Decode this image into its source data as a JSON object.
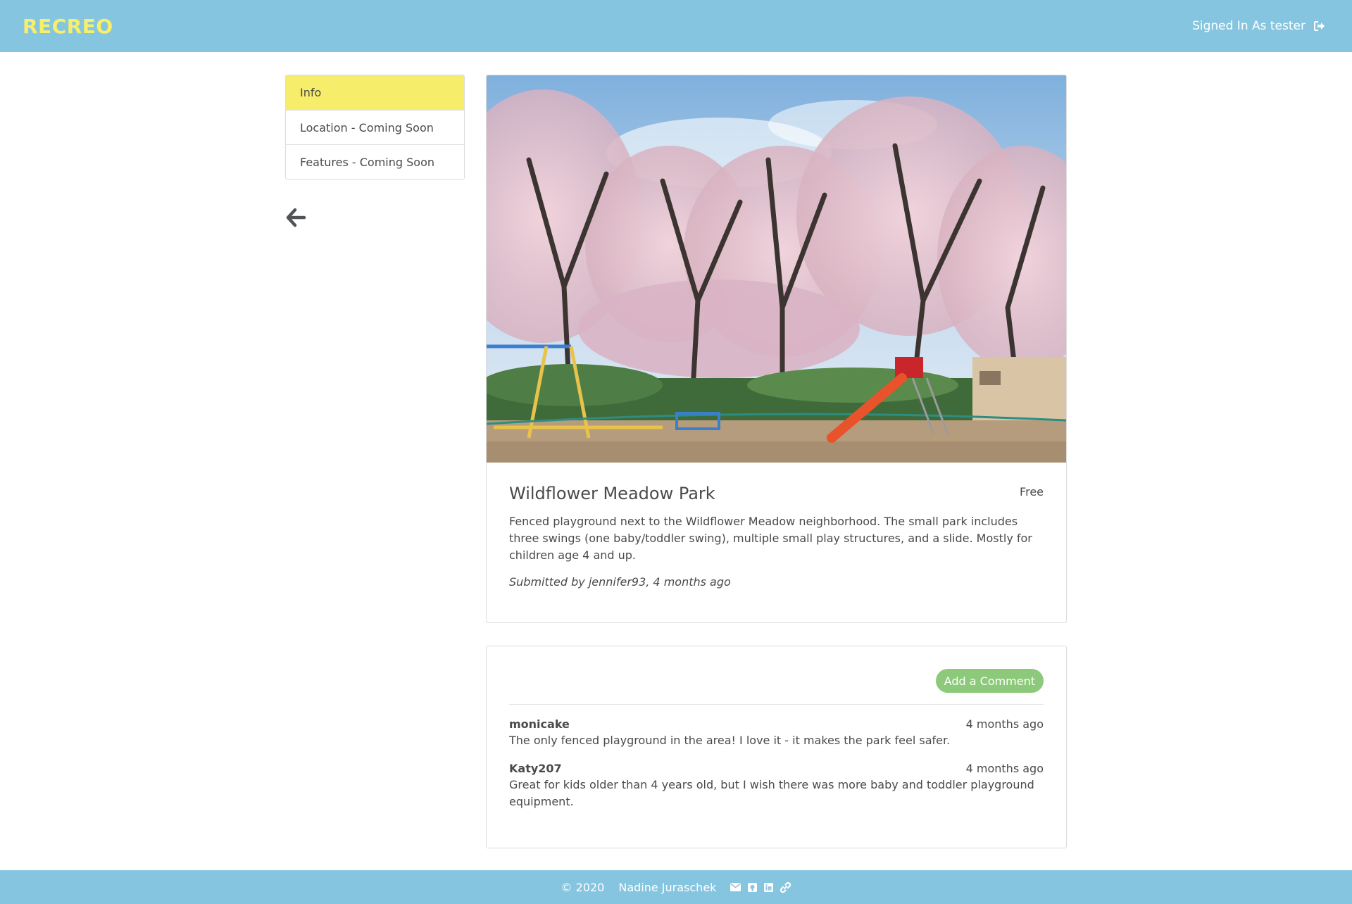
{
  "navbar": {
    "brand": "RECREO",
    "signed_in_text": "Signed In As tester",
    "signout_icon": "sign-out-icon"
  },
  "sidebar": {
    "items": [
      {
        "label": "Info",
        "active": true
      },
      {
        "label": "Location - Coming Soon",
        "active": false
      },
      {
        "label": "Features - Coming Soon",
        "active": false
      }
    ],
    "back_icon": "arrow-left-icon"
  },
  "park": {
    "title": "Wildflower Meadow Park",
    "price": "Free",
    "description": "Fenced playground next to the Wildflower Meadow neighborhood. The small park includes three swings (one baby/toddler swing), multiple small play structures, and a slide. Mostly for children age 4 and up.",
    "submitted": "Submitted by jennifer93, 4 months ago"
  },
  "comments": {
    "add_button": "Add a Comment",
    "items": [
      {
        "author": "monicake",
        "time": "4 months ago",
        "text": "The only fenced playground in the area! I love it - it makes the park feel safer."
      },
      {
        "author": "Katy207",
        "time": "4 months ago",
        "text": "Great for kids older than 4 years old, but I wish there was more baby and toddler playground equipment."
      }
    ]
  },
  "footer": {
    "copyright": "© 2020",
    "author": "Nadine Juraschek",
    "icons": [
      "envelope-icon",
      "github-icon",
      "linkedin-icon",
      "link-icon"
    ]
  },
  "colors": {
    "navbar": "#86c5e0",
    "brand": "#f7ef6a",
    "active_tab": "#f6ee6b",
    "add_button": "#8cc97a"
  }
}
